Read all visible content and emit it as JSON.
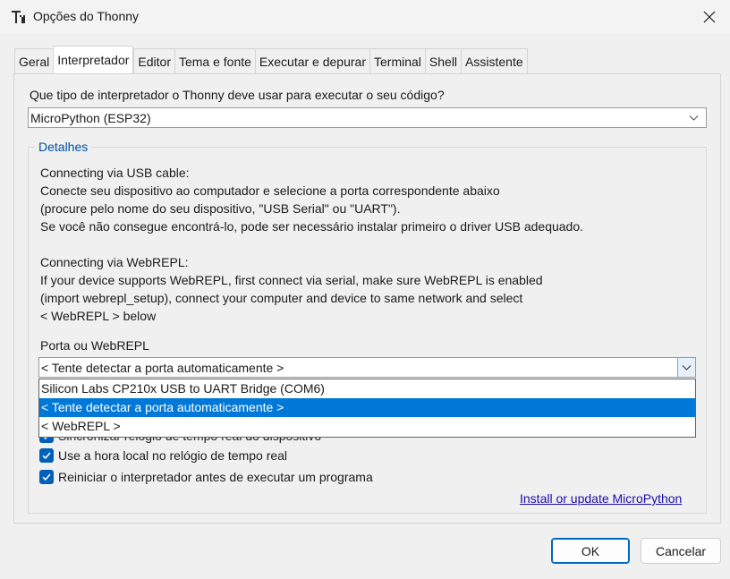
{
  "window": {
    "title": "Opções do Thonny",
    "icon": "thonny-logo-icon"
  },
  "tabs": [
    {
      "label": "Geral"
    },
    {
      "label": "Interpretador"
    },
    {
      "label": "Editor"
    },
    {
      "label": "Tema e fonte"
    },
    {
      "label": "Executar e depurar"
    },
    {
      "label": "Terminal"
    },
    {
      "label": "Shell"
    },
    {
      "label": "Assistente"
    }
  ],
  "active_tab": "Interpretador",
  "interpreter": {
    "question": "Que tipo de interpretador o Thonny deve usar para executar o seu código?",
    "selected": "MicroPython (ESP32)"
  },
  "details": {
    "legend": "Detalhes",
    "usb_lines": [
      "Connecting via USB cable:",
      "Conecte seu dispositivo ao computador e selecione a porta correspondente abaixo",
      "(procure pelo nome do seu dispositivo, \"USB Serial\" ou \"UART\").",
      "Se você não consegue encontrá-lo, pode ser necessário instalar primeiro o driver USB adequado."
    ],
    "webrepl_lines": [
      "Connecting via WebREPL:",
      "If your device supports WebREPL, first connect via serial, make sure WebREPL is enabled",
      "(import webrepl_setup), connect your computer and device to same network and select",
      "< WebREPL > below"
    ],
    "port_label": "Porta ou WebREPL",
    "port_value": "< Tente detectar a porta automaticamente >",
    "port_options": [
      "Silicon Labs CP210x USB to UART Bridge (COM6)",
      "< Tente detectar a porta automaticamente >",
      "< WebREPL >"
    ],
    "hidden_checkbox_label": "Sincronizar relógio de tempo real do dispositivo",
    "checkboxes": [
      {
        "label": "Use a hora local no relógio de tempo real",
        "checked": true
      },
      {
        "label": "Reiniciar o interpretador antes de executar um programa",
        "checked": true
      }
    ],
    "install_link": "Install or update MicroPython"
  },
  "buttons": {
    "ok": "OK",
    "cancel": "Cancelar"
  },
  "colors": {
    "accent": "#0078d7",
    "checkbox": "#005fb8",
    "legend": "#0050a6",
    "link": "#1a0dab"
  }
}
